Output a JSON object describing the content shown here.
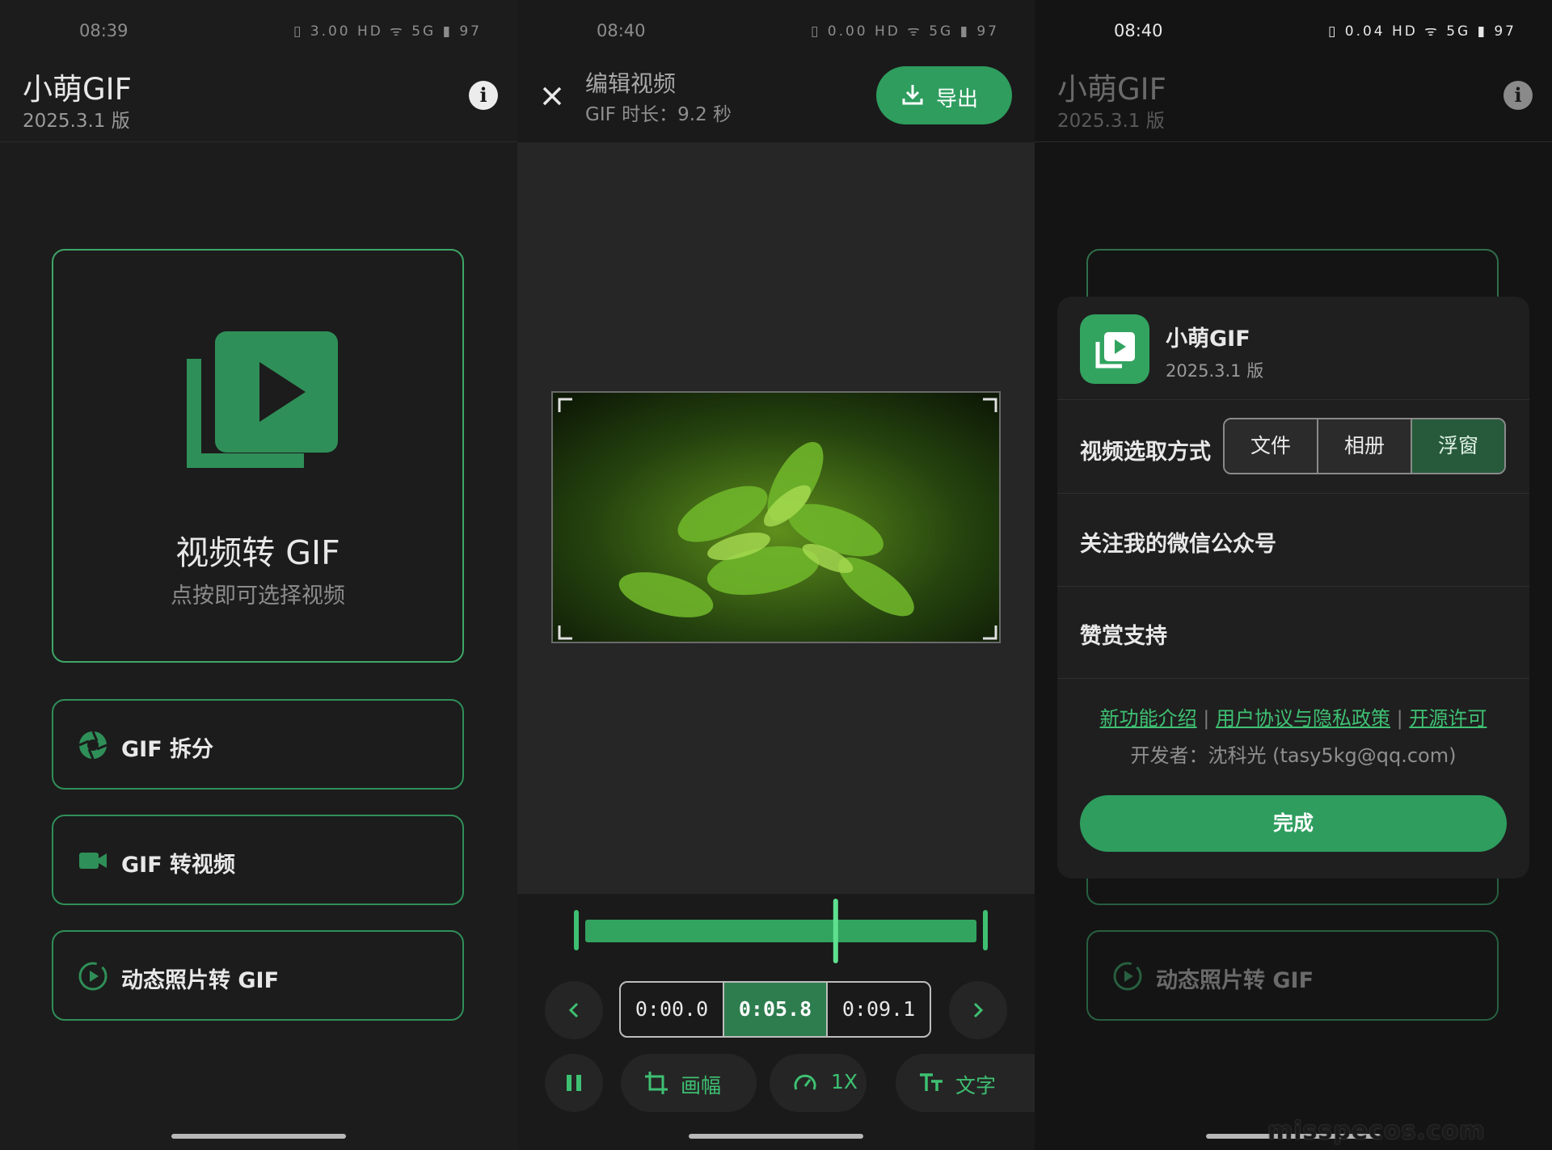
{
  "screen_home": {
    "status_time": "08:39",
    "status_icons": "▯ 3.00 HD ᯤ 5G ▮ 97",
    "app_title": "小萌GIF",
    "app_version": "2025.3.1 版",
    "main_card": {
      "title": "视频转 GIF",
      "subtitle": "点按即可选择视频"
    },
    "rows": [
      {
        "label": "GIF 拆分"
      },
      {
        "label": "GIF 转视频"
      },
      {
        "label": "动态照片转 GIF"
      }
    ]
  },
  "screen_edit": {
    "status_time": "08:40",
    "status_icons": "▯ 0.00 HD ᯤ 5G ▮ 97",
    "title": "编辑视频",
    "duration": "GIF 时长：9.2 秒",
    "export_label": "导出",
    "timecodes": [
      "0:00.0",
      "0:05.8",
      "0:09.1"
    ],
    "playhead_fraction": 0.64,
    "tools": {
      "crop": "画幅",
      "speed": "1X",
      "text": "文字"
    }
  },
  "screen_about": {
    "status_time": "08:40",
    "status_icons": "▯ 0.04 HD ᯤ 5G ▮ 97",
    "app_title": "小萌GIF",
    "app_version": "2025.3.1 版",
    "sheet": {
      "name": "小萌GIF",
      "version": "2025.3.1 版",
      "pick_label": "视频选取方式",
      "pick_options": [
        "文件",
        "相册",
        "浮窗"
      ],
      "follow": "关注我的微信公众号",
      "donate": "赞赏支持",
      "link_features": "新功能介绍",
      "link_terms": "用户协议与隐私政策",
      "link_license": "开源许可",
      "link_sep": "|",
      "developer": "开发者：沈科光 (tasy5kg@qq.com)",
      "done": "完成"
    },
    "bg_row_label": "动态照片转 GIF"
  },
  "watermark": "misspecos.com",
  "colors": {
    "accent": "#2e9d5e",
    "accent_text": "#3ec072",
    "card_border": "#3ea668"
  }
}
